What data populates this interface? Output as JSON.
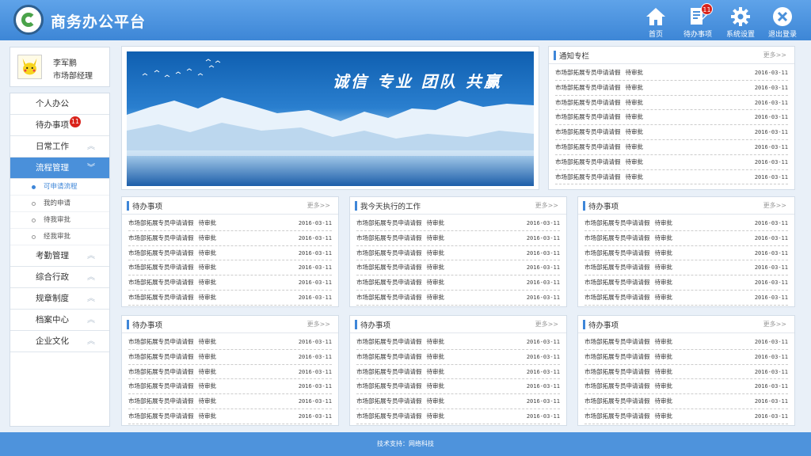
{
  "app": {
    "title": "商务办公平台"
  },
  "nav": [
    {
      "label": "首页",
      "icon": "home-icon"
    },
    {
      "label": "待办事项",
      "icon": "todo-icon",
      "badge": "11"
    },
    {
      "label": "系统设置",
      "icon": "gear-icon"
    },
    {
      "label": "退出登录",
      "icon": "close-icon"
    }
  ],
  "user": {
    "name": "李军鹏",
    "role": "市场部经理"
  },
  "menu": {
    "personal": "个人办公",
    "todo": "待办事项",
    "todo_badge": "11",
    "daily": "日常工作",
    "process": "流程管理",
    "sub": [
      "可申请流程",
      "我的申请",
      "待我审批",
      "经我审批"
    ],
    "attendance": "考勤管理",
    "admin": "综合行政",
    "rules": "规章制度",
    "archive": "档案中心",
    "culture": "企业文化"
  },
  "banner": {
    "slogan": "诚信  专业  团队  共赢"
  },
  "more_label": "更多>>",
  "notice": {
    "title": "通知专栏",
    "rows": [
      {
        "text": "市场部拓展专员申请请假",
        "status": "待审批",
        "date": "2016-03-11"
      },
      {
        "text": "市场部拓展专员申请请假",
        "status": "待审批",
        "date": "2016-03-11"
      },
      {
        "text": "市场部拓展专员申请请假",
        "status": "待审批",
        "date": "2016-03-11"
      },
      {
        "text": "市场部拓展专员申请请假",
        "status": "待审批",
        "date": "2016-03-11"
      },
      {
        "text": "市场部拓展专员申请请假",
        "status": "待审批",
        "date": "2016-03-11"
      },
      {
        "text": "市场部拓展专员申请请假",
        "status": "待审批",
        "date": "2016-03-11"
      },
      {
        "text": "市场部拓展专员申请请假",
        "status": "待审批",
        "date": "2016-03-11"
      },
      {
        "text": "市场部拓展专员申请请假",
        "status": "待审批",
        "date": "2016-03-11"
      }
    ]
  },
  "panels": [
    {
      "title": "待办事项"
    },
    {
      "title": "我今天执行的工作"
    },
    {
      "title": "待办事项"
    },
    {
      "title": "待办事项"
    },
    {
      "title": "待办事项"
    },
    {
      "title": "待办事项"
    }
  ],
  "panel_row": {
    "text": "市场部拓展专员申请请假",
    "status": "待审批",
    "date": "2016-03-11"
  },
  "footer": {
    "text": "技术支持：网络科技"
  },
  "colors": {
    "header": "#4a90da",
    "accent": "#3e86d8",
    "badge": "#d9231b"
  }
}
